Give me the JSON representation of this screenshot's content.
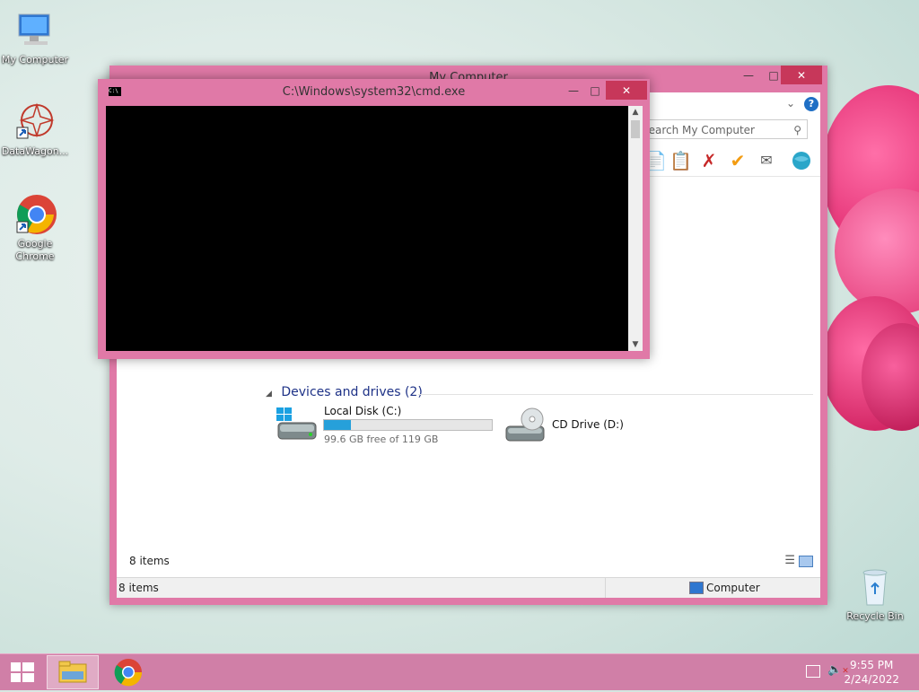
{
  "desktop": {
    "icons": [
      {
        "label": "My Computer",
        "icon": "computer-icon"
      },
      {
        "label": "DataWagon...",
        "icon": "datawagon-icon"
      },
      {
        "label": "Google Chrome",
        "icon": "chrome-icon"
      },
      {
        "label": "Recycle Bin",
        "icon": "recycle-bin-icon"
      }
    ]
  },
  "explorer": {
    "title": "My Computer",
    "search_placeholder": "Search My Computer",
    "toolbar_icons": [
      "copy-icon",
      "paste-icon",
      "delete-icon",
      "checkmark-icon",
      "rename-icon",
      "globe-icon"
    ],
    "group_heading": "Devices and drives (2)",
    "drives": [
      {
        "name": "Local Disk (C:)",
        "free_text": "99.6 GB free of 119 GB",
        "used_fraction": 0.16,
        "icon": "hard-drive-icon"
      },
      {
        "name": "CD Drive (D:)",
        "icon": "cd-drive-icon"
      }
    ],
    "item_count": "8 items",
    "status_count": "8 items",
    "status_location": "Computer"
  },
  "cmd": {
    "title": "C:\\Windows\\system32\\cmd.exe"
  },
  "taskbar": {
    "time": "9:55 PM",
    "date": "2/24/2022",
    "apps": [
      "start-icon",
      "file-explorer-icon",
      "chrome-icon"
    ]
  },
  "colors": {
    "window_frame": "#e079a7",
    "close_button": "#c7375a",
    "taskbar": "#d07fa7",
    "progress": "#26a0da"
  }
}
